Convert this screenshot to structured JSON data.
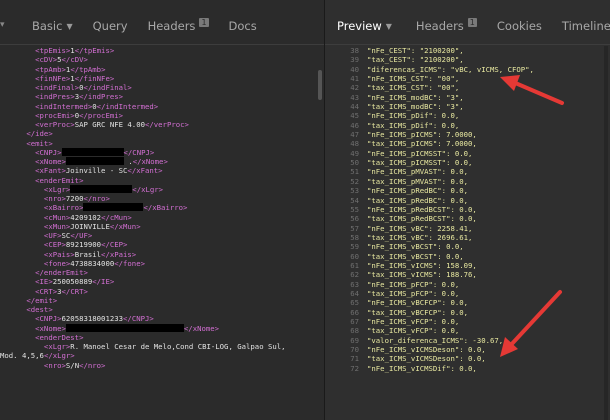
{
  "left_panel": {
    "tabs": [
      {
        "label": "Basic",
        "caret": "▼"
      },
      {
        "label": "Query"
      },
      {
        "label": "Headers",
        "badge": "1"
      },
      {
        "label": "Docs"
      }
    ],
    "code_lines": [
      [
        {
          "t": "tag",
          "v": "        <tpEmis>"
        },
        {
          "t": "txt",
          "v": "1"
        },
        {
          "t": "tag",
          "v": "</tpEmis>"
        }
      ],
      [
        {
          "t": "tag",
          "v": "        <cDV>"
        },
        {
          "t": "txt",
          "v": "5"
        },
        {
          "t": "tag",
          "v": "</cDV>"
        }
      ],
      [
        {
          "t": "tag",
          "v": "        <tpAmb>"
        },
        {
          "t": "txt",
          "v": "1"
        },
        {
          "t": "tag",
          "v": "</tpAmb>"
        }
      ],
      [
        {
          "t": "tag",
          "v": "        <finNFe>"
        },
        {
          "t": "txt",
          "v": "1"
        },
        {
          "t": "tag",
          "v": "</finNFe>"
        }
      ],
      [
        {
          "t": "tag",
          "v": "        <indFinal>"
        },
        {
          "t": "txt",
          "v": "0"
        },
        {
          "t": "tag",
          "v": "</indFinal>"
        }
      ],
      [
        {
          "t": "tag",
          "v": "        <indPres>"
        },
        {
          "t": "txt",
          "v": "3"
        },
        {
          "t": "tag",
          "v": "</indPres>"
        }
      ],
      [
        {
          "t": "tag",
          "v": "        <indIntermed>"
        },
        {
          "t": "txt",
          "v": "0"
        },
        {
          "t": "tag",
          "v": "</indIntermed>"
        }
      ],
      [
        {
          "t": "tag",
          "v": "        <procEmi>"
        },
        {
          "t": "txt",
          "v": "0"
        },
        {
          "t": "tag",
          "v": "</procEmi>"
        }
      ],
      [
        {
          "t": "tag",
          "v": "        <verProc>"
        },
        {
          "t": "txt",
          "v": "SAP GRC NFE 4.00"
        },
        {
          "t": "tag",
          "v": "</verProc>"
        }
      ],
      [
        {
          "t": "tag",
          "v": "      </ide>"
        }
      ],
      [
        {
          "t": "tag",
          "v": "      <emit>"
        }
      ],
      [
        {
          "t": "tag",
          "v": "        <CNPJ>"
        },
        {
          "t": "redact",
          "w": 62
        },
        {
          "t": "tag",
          "v": "</CNPJ>"
        }
      ],
      [
        {
          "t": "tag",
          "v": "        <xNome>"
        },
        {
          "t": "redact",
          "w": 58
        },
        {
          "t": "txt",
          "v": " ."
        },
        {
          "t": "tag",
          "v": "</xNome>"
        }
      ],
      [
        {
          "t": "tag",
          "v": "        <xFant>"
        },
        {
          "t": "txt",
          "v": "Joinville - SC"
        },
        {
          "t": "tag",
          "v": "</xFant>"
        }
      ],
      [
        {
          "t": "tag",
          "v": "        <enderEmit>"
        }
      ],
      [
        {
          "t": "tag",
          "v": "          <xLgr>"
        },
        {
          "t": "redact",
          "w": 62
        },
        {
          "t": "tag",
          "v": "</xLgr>"
        }
      ],
      [
        {
          "t": "tag",
          "v": "          <nro>"
        },
        {
          "t": "txt",
          "v": "7200"
        },
        {
          "t": "tag",
          "v": "</nro>"
        }
      ],
      [
        {
          "t": "tag",
          "v": "          <xBairro>"
        },
        {
          "t": "redact",
          "w": 60
        },
        {
          "t": "tag",
          "v": "</xBairro>"
        }
      ],
      [
        {
          "t": "tag",
          "v": "          <cMun>"
        },
        {
          "t": "txt",
          "v": "4209102"
        },
        {
          "t": "tag",
          "v": "</cMun>"
        }
      ],
      [
        {
          "t": "tag",
          "v": "          <xMun>"
        },
        {
          "t": "txt",
          "v": "JOINVILLE"
        },
        {
          "t": "tag",
          "v": "</xMun>"
        }
      ],
      [
        {
          "t": "tag",
          "v": "          <UF>"
        },
        {
          "t": "txt",
          "v": "SC"
        },
        {
          "t": "tag",
          "v": "</UF>"
        }
      ],
      [
        {
          "t": "tag",
          "v": "          <CEP>"
        },
        {
          "t": "txt",
          "v": "89219900"
        },
        {
          "t": "tag",
          "v": "</CEP>"
        }
      ],
      [
        {
          "t": "tag",
          "v": "          <xPais>"
        },
        {
          "t": "txt",
          "v": "Brasil"
        },
        {
          "t": "tag",
          "v": "</xPais>"
        }
      ],
      [
        {
          "t": "tag",
          "v": "          <fone>"
        },
        {
          "t": "txt",
          "v": "4738834000"
        },
        {
          "t": "tag",
          "v": "</fone>"
        }
      ],
      [
        {
          "t": "tag",
          "v": "        </enderEmit>"
        }
      ],
      [
        {
          "t": "tag",
          "v": "        <IE>"
        },
        {
          "t": "txt",
          "v": "250050889"
        },
        {
          "t": "tag",
          "v": "</IE>"
        }
      ],
      [
        {
          "t": "tag",
          "v": "        <CRT>"
        },
        {
          "t": "txt",
          "v": "3"
        },
        {
          "t": "tag",
          "v": "</CRT>"
        }
      ],
      [
        {
          "t": "tag",
          "v": "      </emit>"
        }
      ],
      [
        {
          "t": "tag",
          "v": "      <dest>"
        }
      ],
      [
        {
          "t": "tag",
          "v": "        <CNPJ>"
        },
        {
          "t": "txt",
          "v": "62058318001233"
        },
        {
          "t": "tag",
          "v": "</CNPJ>"
        }
      ],
      [
        {
          "t": "tag",
          "v": "        <xNome>"
        },
        {
          "t": "redact",
          "w": 118
        },
        {
          "t": "tag",
          "v": "</xNome>"
        }
      ],
      [
        {
          "t": "tag",
          "v": "        <enderDest>"
        }
      ],
      [
        {
          "t": "tag",
          "v": "          <xLgr>"
        },
        {
          "t": "txt",
          "v": "R. Manoel Cesar de Melo,Cond CBI-LOG, Galpao Sul,"
        }
      ],
      [
        {
          "t": "txt",
          "v": "Mod. 4,5,6"
        },
        {
          "t": "tag",
          "v": "</xLgr>"
        }
      ],
      [
        {
          "t": "tag",
          "v": "          <nro>"
        },
        {
          "t": "txt",
          "v": "S/N"
        },
        {
          "t": "tag",
          "v": "</nro>"
        }
      ]
    ]
  },
  "right_panel": {
    "tabs": [
      {
        "label": "Preview",
        "caret": "▼"
      },
      {
        "label": "Headers",
        "badge": "1"
      },
      {
        "label": "Cookies"
      },
      {
        "label": "Timeline"
      }
    ],
    "json_lines": [
      {
        "n": "38",
        "text": "\"nFe_CEST\": \"2100200\","
      },
      {
        "n": "39",
        "text": "\"tax_CEST\": \"2100200\","
      },
      {
        "n": "40",
        "text": "\"diferencas_ICMS\": \"vBC, vICMS, CFOP\","
      },
      {
        "n": "41",
        "text": "\"nFe_ICMS_CST\": \"00\","
      },
      {
        "n": "42",
        "text": "\"tax_ICMS_CST\": \"00\","
      },
      {
        "n": "43",
        "text": "\"nFe_ICMS_modBC\": \"3\","
      },
      {
        "n": "44",
        "text": "\"tax_ICMS_modBC\": \"3\","
      },
      {
        "n": "45",
        "text": "\"nFe_ICMS_pDif\": 0.0,"
      },
      {
        "n": "46",
        "text": "\"tax_ICMS_pDif\": 0.0,"
      },
      {
        "n": "47",
        "text": "\"nFe_ICMS_pICMS\": 7.0000,"
      },
      {
        "n": "48",
        "text": "\"tax_ICMS_pICMS\": 7.0000,"
      },
      {
        "n": "49",
        "text": "\"nFe_ICMS_pICMSST\": 0.0,"
      },
      {
        "n": "50",
        "text": "\"tax_ICMS_pICMSST\": 0.0,"
      },
      {
        "n": "51",
        "text": "\"nFe_ICMS_pMVAST\": 0.0,"
      },
      {
        "n": "52",
        "text": "\"tax_ICMS_pMVAST\": 0.0,"
      },
      {
        "n": "53",
        "text": "\"nFe_ICMS_pRedBC\": 0.0,"
      },
      {
        "n": "54",
        "text": "\"tax_ICMS_pRedBC\": 0.0,"
      },
      {
        "n": "55",
        "text": "\"nFe_ICMS_pRedBCST\": 0.0,"
      },
      {
        "n": "56",
        "text": "\"tax_ICMS_pRedBCST\": 0.0,"
      },
      {
        "n": "57",
        "text": "\"nFe_ICMS_vBC\": 2258.41,"
      },
      {
        "n": "58",
        "text": "\"tax_ICMS_vBC\": 2696.61,"
      },
      {
        "n": "59",
        "text": "\"nFe_ICMS_vBCST\": 0.0,"
      },
      {
        "n": "60",
        "text": "\"tax_ICMS_vBCST\": 0.0,"
      },
      {
        "n": "61",
        "text": "\"nFe_ICMS_vICMS\": 158.09,"
      },
      {
        "n": "62",
        "text": "\"tax_ICMS_vICMS\": 188.76,"
      },
      {
        "n": "63",
        "text": "\"nFe_ICMS_pFCP\": 0.0,"
      },
      {
        "n": "64",
        "text": "\"tax_ICMS_pFCP\": 0.0,"
      },
      {
        "n": "65",
        "text": "\"nFe_ICMS_vBCFCP\": 0.0,"
      },
      {
        "n": "66",
        "text": "\"tax_ICMS_vBCFCP\": 0.0,"
      },
      {
        "n": "67",
        "text": "\"nFe_ICMS_vFCP\": 0.0,"
      },
      {
        "n": "68",
        "text": "\"tax_ICMS_vFCP\": 0.0,"
      },
      {
        "n": "69",
        "text": "\"valor_diferenca_ICMS\": -30.67,"
      },
      {
        "n": "70",
        "text": "\"nFe_ICMS_vICMSDeson\": 0.0,"
      },
      {
        "n": "71",
        "text": "\"tax_ICMS_vICMSDeson\": 0.0,"
      },
      {
        "n": "72",
        "text": "\"nFe_ICMS_vICMSDif\": 0.0,"
      }
    ]
  },
  "colors": {
    "xml_tag": "#d36fd3",
    "xml_text": "#e2e2e2",
    "json_text": "#e8e8a0",
    "arrow": "#e53935"
  }
}
